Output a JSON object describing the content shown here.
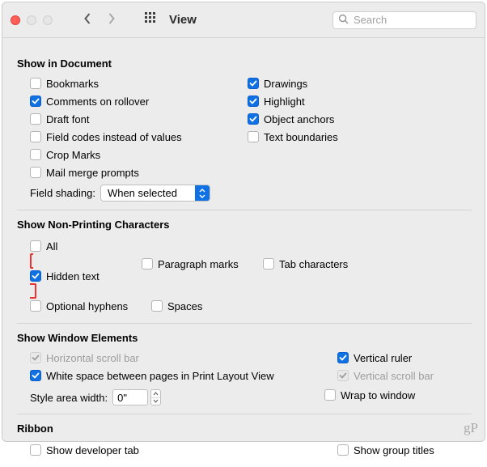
{
  "window": {
    "title": "View",
    "search_placeholder": "Search"
  },
  "sections": {
    "show_in_document": {
      "title": "Show in Document",
      "left": [
        {
          "label": "Bookmarks",
          "checked": false
        },
        {
          "label": "Comments on rollover",
          "checked": true
        },
        {
          "label": "Draft font",
          "checked": false
        },
        {
          "label": "Field codes instead of values",
          "checked": false
        },
        {
          "label": "Crop Marks",
          "checked": false
        },
        {
          "label": "Mail merge prompts",
          "checked": false
        }
      ],
      "right": [
        {
          "label": "Drawings",
          "checked": true
        },
        {
          "label": "Highlight",
          "checked": true
        },
        {
          "label": "Object anchors",
          "checked": true
        },
        {
          "label": "Text boundaries",
          "checked": false
        }
      ],
      "field_shading_label": "Field shading:",
      "field_shading_value": "When selected"
    },
    "non_printing": {
      "title": "Show Non-Printing Characters",
      "items": [
        {
          "label": "All",
          "checked": false
        },
        {
          "label": "Hidden text",
          "checked": true,
          "highlight": true
        },
        {
          "label": "Paragraph marks",
          "checked": false
        },
        {
          "label": "Tab characters",
          "checked": false
        },
        {
          "label": "Optional hyphens",
          "checked": false
        },
        {
          "label": "Spaces",
          "checked": false
        }
      ]
    },
    "window_elements": {
      "title": "Show Window Elements",
      "hscroll": {
        "label": "Horizontal scroll bar",
        "checked": true,
        "disabled": true
      },
      "vruler": {
        "label": "Vertical ruler",
        "checked": true
      },
      "whitespace": {
        "label": "White space between pages in Print Layout View",
        "checked": true
      },
      "vscroll": {
        "label": "Vertical scroll bar",
        "checked": true,
        "disabled": true
      },
      "style_width_label": "Style area width:",
      "style_width_value": "0\"",
      "wrap": {
        "label": "Wrap to window",
        "checked": false
      }
    },
    "ribbon": {
      "title": "Ribbon",
      "dev": {
        "label": "Show developer tab",
        "checked": false
      },
      "groups": {
        "label": "Show group titles",
        "checked": false
      }
    }
  },
  "watermark": "gP"
}
